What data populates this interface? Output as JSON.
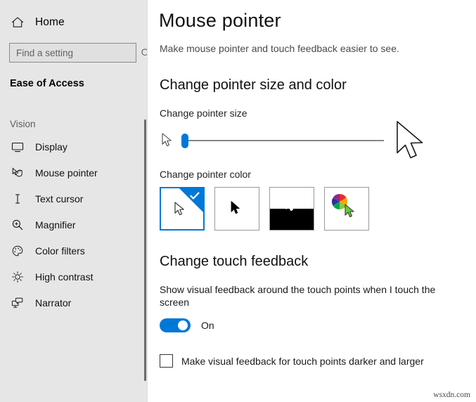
{
  "sidebar": {
    "home": {
      "label": "Home",
      "icon": "home-icon"
    },
    "search": {
      "placeholder": "Find a setting",
      "value": "",
      "icon": "search-icon"
    },
    "category": "Ease of Access",
    "group_label": "Vision",
    "items": [
      {
        "label": "Display",
        "icon": "monitor-icon"
      },
      {
        "label": "Mouse pointer",
        "icon": "mouse-pointer-icon"
      },
      {
        "label": "Text cursor",
        "icon": "text-cursor-icon"
      },
      {
        "label": "Magnifier",
        "icon": "magnifier-icon"
      },
      {
        "label": "Color filters",
        "icon": "palette-icon"
      },
      {
        "label": "High contrast",
        "icon": "brightness-icon"
      },
      {
        "label": "Narrator",
        "icon": "narrator-icon"
      }
    ]
  },
  "main": {
    "title": "Mouse pointer",
    "subtitle": "Make mouse pointer and touch feedback easier to see.",
    "section_size_color": {
      "heading": "Change pointer size and color",
      "size_label": "Change pointer size",
      "slider": {
        "value": 1,
        "min": 1,
        "max": 15
      },
      "color_label": "Change pointer color",
      "swatches": [
        {
          "name": "white-pointer",
          "selected": true
        },
        {
          "name": "black-pointer",
          "selected": false
        },
        {
          "name": "inverted-pointer",
          "selected": false
        },
        {
          "name": "custom-color-pointer",
          "selected": false
        }
      ]
    },
    "section_touch": {
      "heading": "Change touch feedback",
      "toggle_description": "Show visual feedback around the touch points when I touch the screen",
      "toggle_state": "On",
      "checkbox_label": "Make visual feedback for touch points darker and larger",
      "checkbox_checked": false
    }
  },
  "watermark": "wsxdn.com",
  "colors": {
    "accent": "#0078d7",
    "sidebar_bg": "#e6e6e6",
    "main_bg": "#ffffff"
  }
}
